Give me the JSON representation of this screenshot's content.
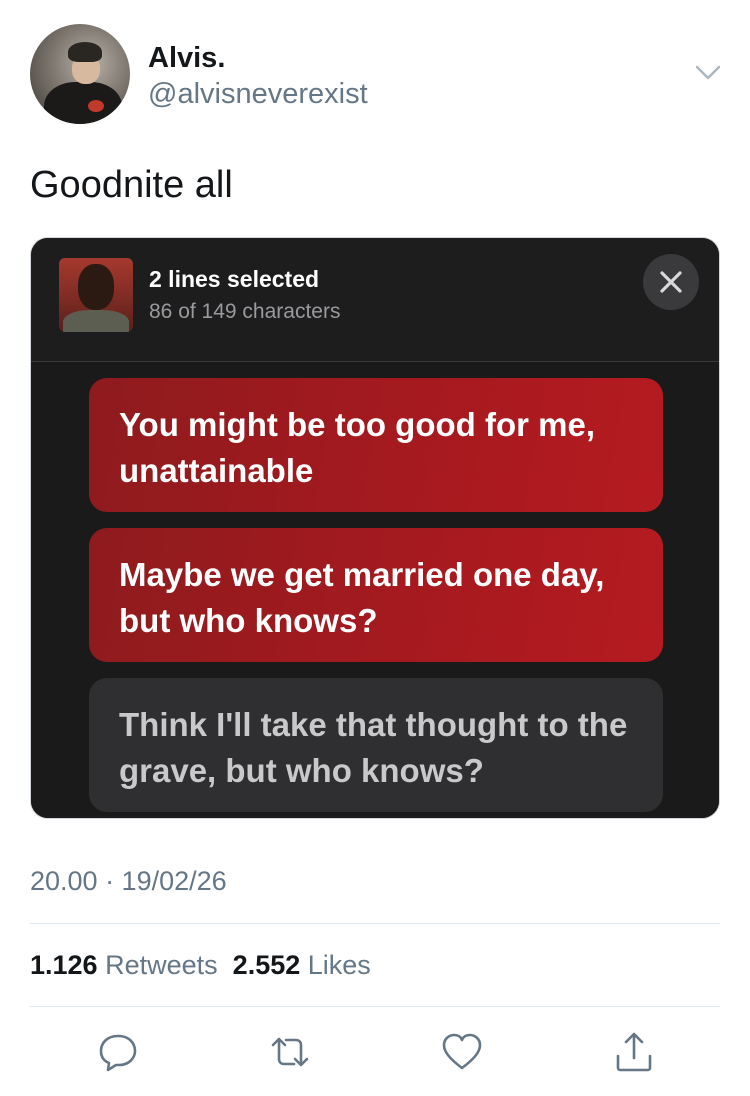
{
  "user": {
    "name": "Alvis.",
    "handle": "@alvisneverexist"
  },
  "tweet": {
    "text": "Goodnite all",
    "timestamp": "20.00 · 19/02/26"
  },
  "media": {
    "selection_title": "2 lines selected",
    "selection_count": "86 of 149 characters",
    "lyrics": [
      {
        "text": "You might be too good for me, unattainable",
        "selected": true
      },
      {
        "text": "Maybe we get married one day, but who knows?",
        "selected": true
      },
      {
        "text": "Think I'll take that thought to the grave, but who knows?",
        "selected": false
      }
    ],
    "colors": {
      "selected": "#a51a1f",
      "unselected": "#2f2f31",
      "background": "#1a1a1b"
    }
  },
  "stats": {
    "retweets_count": "1.126",
    "retweets_label": "Retweets",
    "likes_count": "2.552",
    "likes_label": "Likes"
  },
  "actions": [
    "reply-icon",
    "retweet-icon",
    "like-icon",
    "share-icon"
  ]
}
